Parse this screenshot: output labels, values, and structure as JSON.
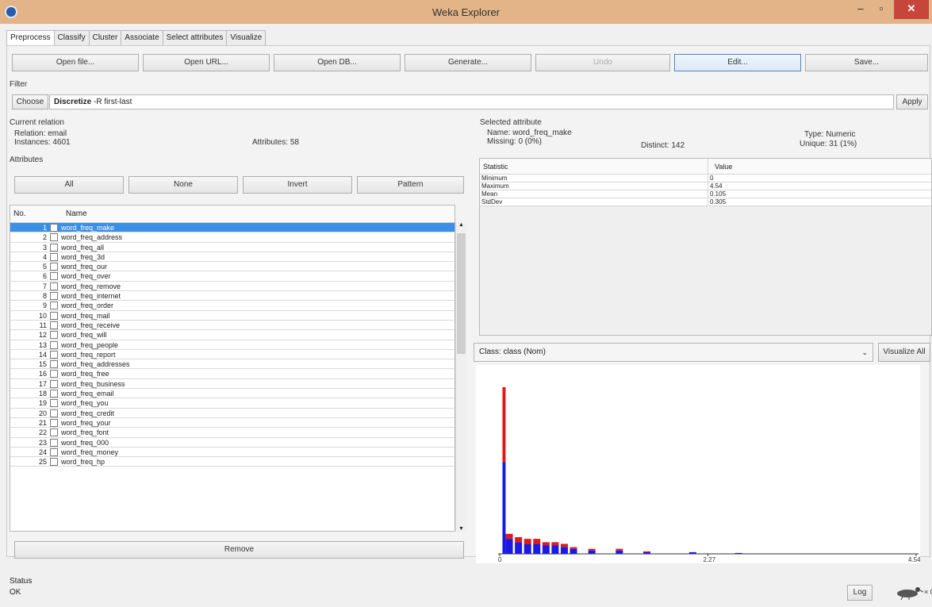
{
  "window": {
    "title": "Weka Explorer",
    "minimize": "–",
    "maximize": "▫",
    "close": "✕"
  },
  "tabs": [
    "Preprocess",
    "Classify",
    "Cluster",
    "Associate",
    "Select attributes",
    "Visualize"
  ],
  "toolbar": {
    "open_file": "Open file...",
    "open_url": "Open URL...",
    "open_db": "Open DB...",
    "generate": "Generate...",
    "undo": "Undo",
    "edit": "Edit...",
    "save": "Save..."
  },
  "filter": {
    "heading": "Filter",
    "choose": "Choose",
    "name": "Discretize",
    "options": "-R first-last",
    "apply": "Apply"
  },
  "current_relation": {
    "heading": "Current relation",
    "relation_label": "Relation:",
    "relation": "email",
    "instances_label": "Instances:",
    "instances": "4601",
    "attributes_label": "Attributes:",
    "attributes": "58"
  },
  "attributes_panel": {
    "heading": "Attributes",
    "all": "All",
    "none": "None",
    "invert": "Invert",
    "pattern": "Pattern",
    "col_no": "No.",
    "col_name": "Name",
    "remove": "Remove"
  },
  "attribute_rows": [
    {
      "no": "1",
      "name": "word_freq_make"
    },
    {
      "no": "2",
      "name": "word_freq_address"
    },
    {
      "no": "3",
      "name": "word_freq_all"
    },
    {
      "no": "4",
      "name": "word_freq_3d"
    },
    {
      "no": "5",
      "name": "word_freq_our"
    },
    {
      "no": "6",
      "name": "word_freq_over"
    },
    {
      "no": "7",
      "name": "word_freq_remove"
    },
    {
      "no": "8",
      "name": "word_freq_internet"
    },
    {
      "no": "9",
      "name": "word_freq_order"
    },
    {
      "no": "10",
      "name": "word_freq_mail"
    },
    {
      "no": "11",
      "name": "word_freq_receive"
    },
    {
      "no": "12",
      "name": "word_freq_will"
    },
    {
      "no": "13",
      "name": "word_freq_people"
    },
    {
      "no": "14",
      "name": "word_freq_report"
    },
    {
      "no": "15",
      "name": "word_freq_addresses"
    },
    {
      "no": "16",
      "name": "word_freq_free"
    },
    {
      "no": "17",
      "name": "word_freq_business"
    },
    {
      "no": "18",
      "name": "word_freq_email"
    },
    {
      "no": "19",
      "name": "word_freq_you"
    },
    {
      "no": "20",
      "name": "word_freq_credit"
    },
    {
      "no": "21",
      "name": "word_freq_your"
    },
    {
      "no": "22",
      "name": "word_freq_font"
    },
    {
      "no": "23",
      "name": "word_freq_000"
    },
    {
      "no": "24",
      "name": "word_freq_money"
    },
    {
      "no": "25",
      "name": "word_freq_hp"
    }
  ],
  "selected_attribute": {
    "heading": "Selected attribute",
    "name_label": "Name:",
    "name": "word_freq_make",
    "missing_label": "Missing:",
    "missing": "0 (0%)",
    "distinct_label": "Distinct:",
    "distinct": "142",
    "type_label": "Type:",
    "type": "Numeric",
    "unique_label": "Unique:",
    "unique": "31 (1%)"
  },
  "stats": {
    "col_stat": "Statistic",
    "col_value": "Value",
    "rows": [
      {
        "stat": "Minimum",
        "value": "0"
      },
      {
        "stat": "Maximum",
        "value": "4.54"
      },
      {
        "stat": "Mean",
        "value": "0.105"
      },
      {
        "stat": "StdDev",
        "value": "0.305"
      }
    ]
  },
  "class_selector": {
    "value": "Class: class (Nom)",
    "visualize_all": "Visualize All"
  },
  "histogram": {
    "tick_labels": [
      "0",
      "2.27",
      "4.54"
    ],
    "colors": {
      "class_1": "#e01a1a",
      "class_0": "#1a1ae0"
    }
  },
  "status": {
    "heading": "Status",
    "text": "OK",
    "log": "Log",
    "x_label": "× 0"
  },
  "chart_data": {
    "type": "bar",
    "title": "",
    "xlabel": "",
    "ylabel": "",
    "xlim": [
      0,
      4.54
    ],
    "x_ticks": [
      "0",
      "2.27",
      "4.54"
    ],
    "series": [
      {
        "name": "",
        "color": "#1a1ae0",
        "values": [
          [
            0.03,
            0.55
          ],
          [
            0.1,
            0.09
          ],
          [
            0.2,
            0.07
          ],
          [
            0.3,
            0.06
          ],
          [
            0.4,
            0.06
          ],
          [
            0.5,
            0.05
          ],
          [
            0.6,
            0.05
          ],
          [
            0.7,
            0.04
          ],
          [
            0.8,
            0.03
          ],
          [
            1.0,
            0.02
          ],
          [
            1.3,
            0.02
          ],
          [
            1.6,
            0.01
          ],
          [
            2.1,
            0.01
          ],
          [
            2.6,
            0.005
          ]
        ]
      },
      {
        "name": "",
        "color": "#e01a1a",
        "values": [
          [
            0.03,
            0.45
          ],
          [
            0.1,
            0.03
          ],
          [
            0.2,
            0.03
          ],
          [
            0.3,
            0.03
          ],
          [
            0.4,
            0.03
          ],
          [
            0.5,
            0.02
          ],
          [
            0.6,
            0.02
          ],
          [
            0.7,
            0.02
          ],
          [
            0.8,
            0.01
          ],
          [
            1.0,
            0.01
          ],
          [
            1.3,
            0.01
          ],
          [
            1.6,
            0.005
          ],
          [
            2.5,
            0.005
          ]
        ]
      }
    ]
  }
}
